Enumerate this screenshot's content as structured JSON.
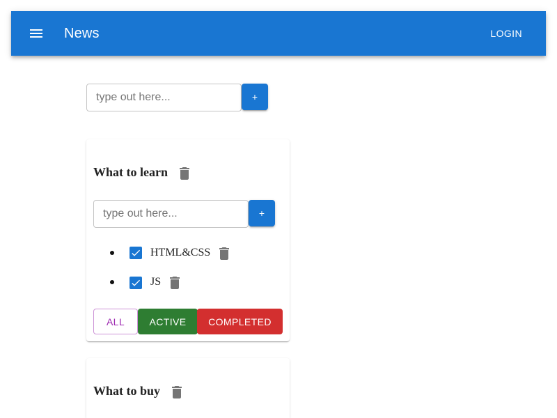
{
  "appbar": {
    "menu_icon": "menu-icon",
    "title": "News",
    "login_label": "LOGIN",
    "color": "#1976d2"
  },
  "add_list": {
    "placeholder": "type out here...",
    "button_label": "+"
  },
  "lists": [
    {
      "title": "What to learn",
      "delete_icon": "trash-icon",
      "input_placeholder": "type out here...",
      "add_label": "+",
      "tasks": [
        {
          "label": "HTML&CSS",
          "checked": true,
          "delete_icon": "trash-icon"
        },
        {
          "label": "JS",
          "checked": true,
          "delete_icon": "trash-icon"
        }
      ],
      "filters": {
        "all": "ALL",
        "active": "ACTIVE",
        "completed": "COMPLETED"
      }
    },
    {
      "title": "What to buy",
      "delete_icon": "trash-icon"
    }
  ],
  "colors": {
    "primary": "#1976d2",
    "filter_all": "#9c27b0",
    "filter_active": "#2e7d32",
    "filter_completed": "#d32f2f"
  }
}
